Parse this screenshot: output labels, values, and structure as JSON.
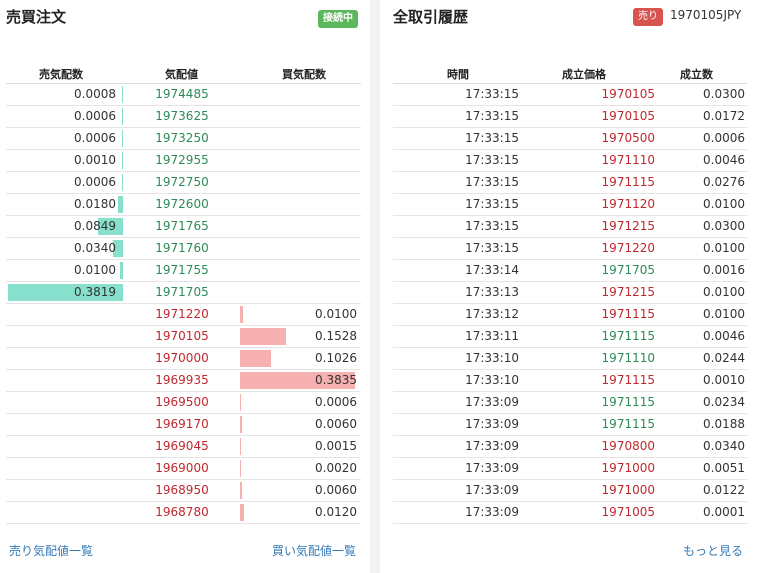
{
  "orderbook": {
    "title": "売買注文",
    "status_badge": "接続中",
    "headers": {
      "ask_qty": "売気配数",
      "price": "気配値",
      "bid_qty": "買気配数"
    },
    "asks": [
      {
        "qty": "0.0008",
        "price": "1974485",
        "depth": 0.0008
      },
      {
        "qty": "0.0006",
        "price": "1973625",
        "depth": 0.0006
      },
      {
        "qty": "0.0006",
        "price": "1973250",
        "depth": 0.0006
      },
      {
        "qty": "0.0010",
        "price": "1972955",
        "depth": 0.001
      },
      {
        "qty": "0.0006",
        "price": "1972750",
        "depth": 0.0006
      },
      {
        "qty": "0.0180",
        "price": "1972600",
        "depth": 0.018
      },
      {
        "qty": "0.0849",
        "price": "1971765",
        "depth": 0.0849
      },
      {
        "qty": "0.0340",
        "price": "1971760",
        "depth": 0.034
      },
      {
        "qty": "0.0100",
        "price": "1971755",
        "depth": 0.01
      },
      {
        "qty": "0.3819",
        "price": "1971705",
        "depth": 0.3819
      }
    ],
    "bids": [
      {
        "qty": "0.0100",
        "price": "1971220",
        "depth": 0.01
      },
      {
        "qty": "0.1528",
        "price": "1970105",
        "depth": 0.1528
      },
      {
        "qty": "0.1026",
        "price": "1970000",
        "depth": 0.1026
      },
      {
        "qty": "0.3835",
        "price": "1969935",
        "depth": 0.3835
      },
      {
        "qty": "0.0006",
        "price": "1969500",
        "depth": 0.0006
      },
      {
        "qty": "0.0060",
        "price": "1969170",
        "depth": 0.006
      },
      {
        "qty": "0.0015",
        "price": "1969045",
        "depth": 0.0015
      },
      {
        "qty": "0.0020",
        "price": "1969000",
        "depth": 0.002
      },
      {
        "qty": "0.0060",
        "price": "1968950",
        "depth": 0.006
      },
      {
        "qty": "0.0120",
        "price": "1968780",
        "depth": 0.012
      }
    ],
    "link_asks": "売り気配値一覧",
    "link_bids": "買い気配値一覧"
  },
  "trades": {
    "title": "全取引履歴",
    "side_badge": "売り",
    "last_price": "1970105JPY",
    "headers": {
      "time": "時間",
      "price": "成立価格",
      "qty": "成立数"
    },
    "rows": [
      {
        "time": "17:33:15",
        "price": "1970105",
        "qty": "0.0300",
        "dir": "down"
      },
      {
        "time": "17:33:15",
        "price": "1970105",
        "qty": "0.0172",
        "dir": "down"
      },
      {
        "time": "17:33:15",
        "price": "1970500",
        "qty": "0.0006",
        "dir": "down"
      },
      {
        "time": "17:33:15",
        "price": "1971110",
        "qty": "0.0046",
        "dir": "down"
      },
      {
        "time": "17:33:15",
        "price": "1971115",
        "qty": "0.0276",
        "dir": "down"
      },
      {
        "time": "17:33:15",
        "price": "1971120",
        "qty": "0.0100",
        "dir": "down"
      },
      {
        "time": "17:33:15",
        "price": "1971215",
        "qty": "0.0300",
        "dir": "down"
      },
      {
        "time": "17:33:15",
        "price": "1971220",
        "qty": "0.0100",
        "dir": "down"
      },
      {
        "time": "17:33:14",
        "price": "1971705",
        "qty": "0.0016",
        "dir": "up"
      },
      {
        "time": "17:33:13",
        "price": "1971215",
        "qty": "0.0100",
        "dir": "down"
      },
      {
        "time": "17:33:12",
        "price": "1971115",
        "qty": "0.0100",
        "dir": "down"
      },
      {
        "time": "17:33:11",
        "price": "1971115",
        "qty": "0.0046",
        "dir": "up"
      },
      {
        "time": "17:33:10",
        "price": "1971110",
        "qty": "0.0244",
        "dir": "up"
      },
      {
        "time": "17:33:10",
        "price": "1971115",
        "qty": "0.0010",
        "dir": "down"
      },
      {
        "time": "17:33:09",
        "price": "1971115",
        "qty": "0.0234",
        "dir": "up"
      },
      {
        "time": "17:33:09",
        "price": "1971115",
        "qty": "0.0188",
        "dir": "up"
      },
      {
        "time": "17:33:09",
        "price": "1970800",
        "qty": "0.0340",
        "dir": "down"
      },
      {
        "time": "17:33:09",
        "price": "1971000",
        "qty": "0.0051",
        "dir": "down"
      },
      {
        "time": "17:33:09",
        "price": "1971000",
        "qty": "0.0122",
        "dir": "down"
      },
      {
        "time": "17:33:09",
        "price": "1971005",
        "qty": "0.0001",
        "dir": "down"
      }
    ],
    "more_link": "もっと見る"
  },
  "colors": {
    "up": "#2e8b57",
    "down": "#c0282d",
    "ask_bar": "#86e0cb",
    "bid_bar": "#f7b0b0",
    "connected": "#5cb85c",
    "sell": "#d9534f",
    "link": "#337ab7"
  }
}
